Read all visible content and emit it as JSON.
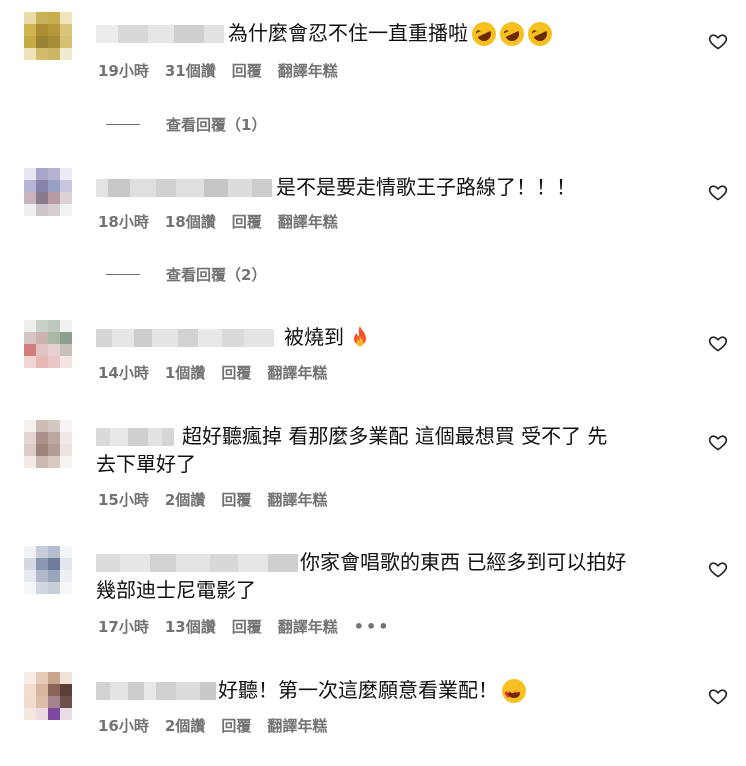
{
  "comments": [
    {
      "text": "為什麼會忍不住一直重播啦",
      "emojis": [
        "rolling-on-floor-laughing",
        "rolling-on-floor-laughing",
        "rolling-on-floor-laughing"
      ],
      "time": "19小時",
      "likes": "31個讚",
      "reply": "回覆",
      "translate": "翻譯年糕",
      "view_replies": "查看回覆（1）"
    },
    {
      "text": "是不是要走情歌王子路線了！！！",
      "time": "18小時",
      "likes": "18個讚",
      "reply": "回覆",
      "translate": "翻譯年糕",
      "view_replies": "查看回覆（2）"
    },
    {
      "text": "被燒到",
      "emojis": [
        "fire"
      ],
      "time": "14小時",
      "likes": "1個讚",
      "reply": "回覆",
      "translate": "翻譯年糕"
    },
    {
      "text_line1": "超好聽瘋掉 看那麼多業配 這個最想買 受不了 先",
      "text_line2": "去下單好了",
      "time": "15小時",
      "likes": "2個讚",
      "reply": "回覆",
      "translate": "翻譯年糕"
    },
    {
      "text_line1": "你家會唱歌的東西 已經多到可以拍好",
      "text_line2": "幾部迪士尼電影了",
      "time": "17小時",
      "likes": "13個讚",
      "reply": "回覆",
      "translate": "翻譯年糕",
      "more": "•••"
    },
    {
      "text": "好聽！第一次這麼願意看業配！",
      "emojis": [
        "smiling-face-with-heart-eyes"
      ],
      "time": "16小時",
      "likes": "2個讚",
      "reply": "回覆",
      "translate": "翻譯年糕"
    }
  ],
  "icons": {
    "like": "heart-outline-icon"
  },
  "colors": {
    "meta": "#737373",
    "text": "#111111"
  }
}
